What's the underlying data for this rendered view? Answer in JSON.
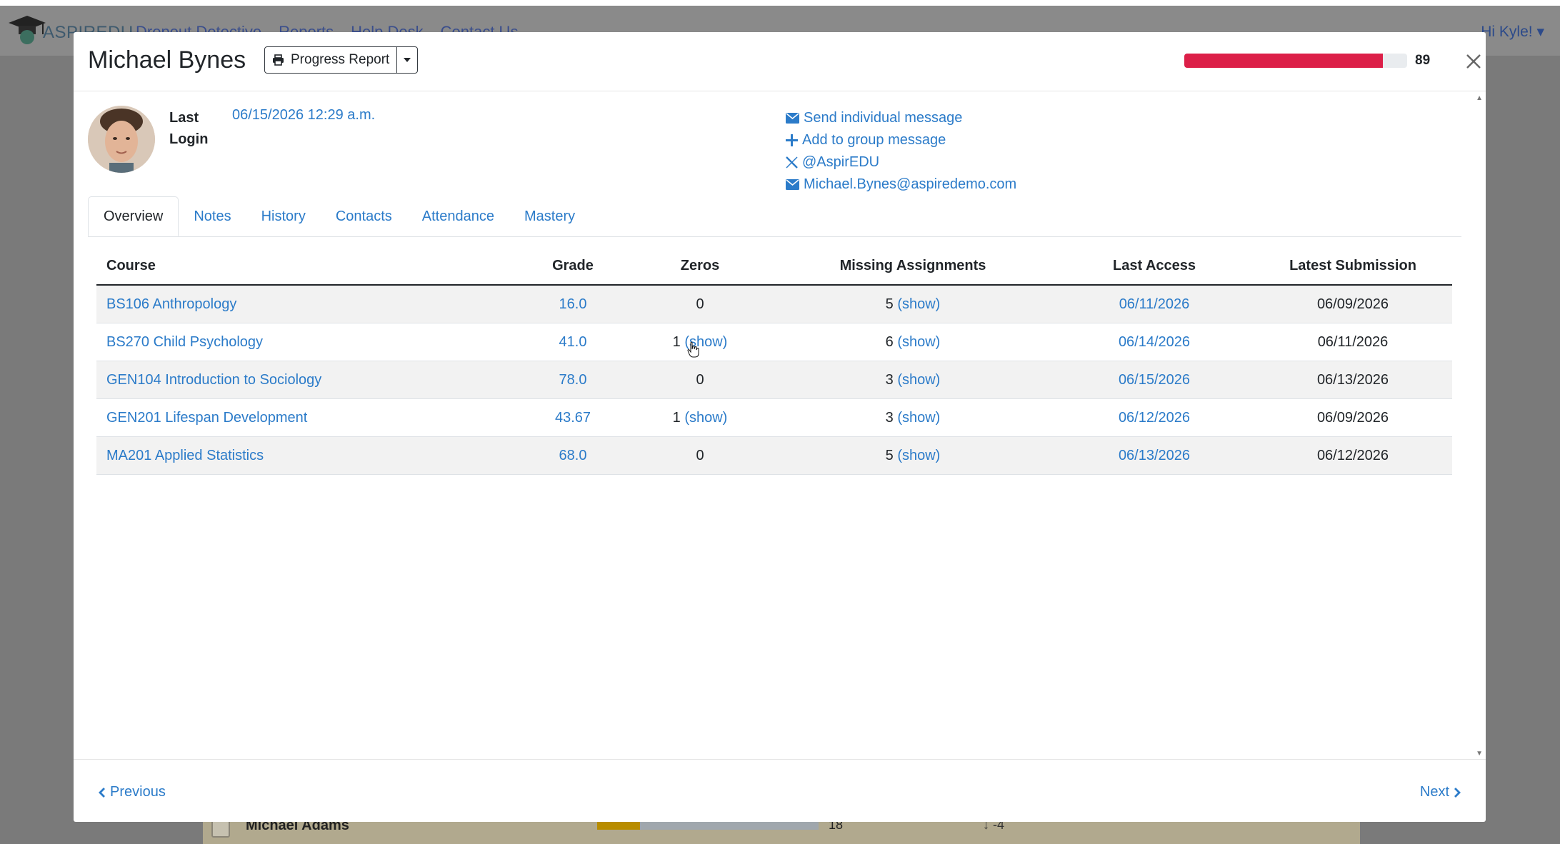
{
  "background": {
    "brand": "ASPIREDU",
    "nav_links": [
      "Dropout Detective",
      "Reports",
      "Help Desk",
      "Contact Us"
    ],
    "greeting": "Hi Kyle!",
    "row_name": "Michael Adams",
    "row_value": "18",
    "row_delta": "-4"
  },
  "header": {
    "student_name": "Michael Bynes",
    "report_label": "Progress Report",
    "risk_score": "89",
    "risk_fraction": 0.89,
    "risk_color": "#dc1f48"
  },
  "profile": {
    "last_login_label": "Last Login",
    "last_login_value": "06/15/2026 12:29 a.m.",
    "send_message": "Send individual message",
    "add_group": "Add to group message",
    "social": "@AspirEDU",
    "email": "Michael.Bynes@aspiredemo.com"
  },
  "tabs": [
    "Overview",
    "Notes",
    "History",
    "Contacts",
    "Attendance",
    "Mastery"
  ],
  "table": {
    "headers": [
      "Course",
      "Grade",
      "Zeros",
      "Missing Assignments",
      "Last Access",
      "Latest Submission"
    ],
    "show_label": "(show)",
    "rows": [
      {
        "course": "BS106 Anthropology",
        "grade": "16.0",
        "zeros": "0",
        "zeros_show": false,
        "missing": "5",
        "last_access": "06/11/2026",
        "latest_submission": "06/09/2026"
      },
      {
        "course": "BS270 Child Psychology",
        "grade": "41.0",
        "zeros": "1",
        "zeros_show": true,
        "missing": "6",
        "last_access": "06/14/2026",
        "latest_submission": "06/11/2026"
      },
      {
        "course": "GEN104 Introduction to Sociology",
        "grade": "78.0",
        "zeros": "0",
        "zeros_show": false,
        "missing": "3",
        "last_access": "06/15/2026",
        "latest_submission": "06/13/2026"
      },
      {
        "course": "GEN201 Lifespan Development",
        "grade": "43.67",
        "zeros": "1",
        "zeros_show": true,
        "missing": "3",
        "last_access": "06/12/2026",
        "latest_submission": "06/09/2026"
      },
      {
        "course": "MA201 Applied Statistics",
        "grade": "68.0",
        "zeros": "0",
        "zeros_show": false,
        "missing": "5",
        "last_access": "06/13/2026",
        "latest_submission": "06/12/2026"
      }
    ]
  },
  "footer": {
    "previous_label": "Previous",
    "next_label": "Next"
  }
}
